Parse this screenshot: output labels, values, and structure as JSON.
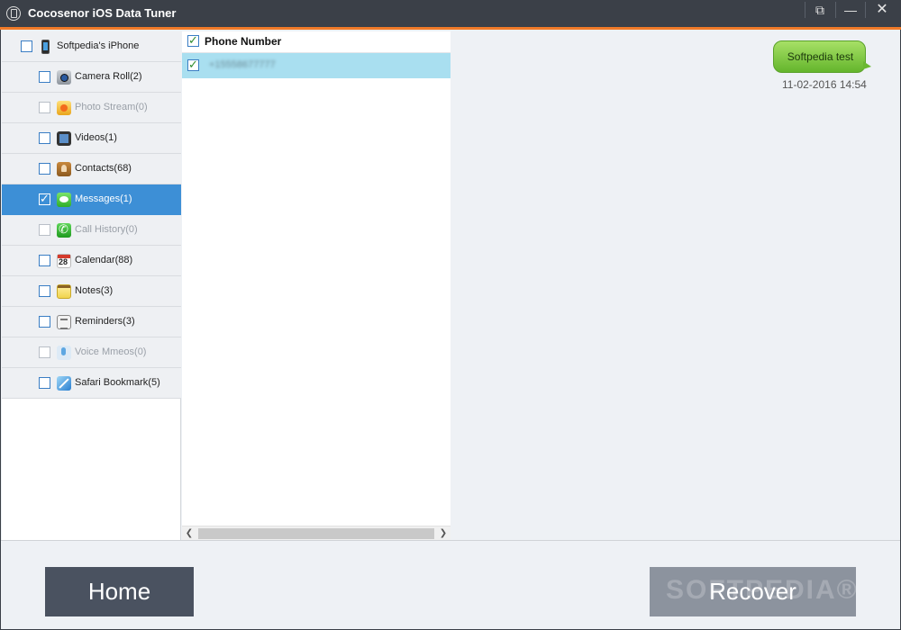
{
  "window": {
    "title": "Cocosenor iOS Data Tuner",
    "controls": [
      "restore-icon",
      "minimize-icon",
      "close-icon"
    ],
    "accent_color": "#f07a28"
  },
  "sidebar": {
    "device": {
      "label": "Softpedia's iPhone",
      "icon": "iphone-icon",
      "checked": false
    },
    "items": [
      {
        "label": "Camera Roll(2)",
        "icon": "camera-icon",
        "checked": false,
        "enabled": true
      },
      {
        "label": "Photo Stream(0)",
        "icon": "photo-stream-icon",
        "checked": false,
        "enabled": false
      },
      {
        "label": "Videos(1)",
        "icon": "video-icon",
        "checked": false,
        "enabled": true
      },
      {
        "label": "Contacts(68)",
        "icon": "contacts-icon",
        "checked": false,
        "enabled": true
      },
      {
        "label": "Messages(1)",
        "icon": "messages-icon",
        "checked": true,
        "enabled": true,
        "selected": true
      },
      {
        "label": "Call History(0)",
        "icon": "phone-call-icon",
        "checked": false,
        "enabled": false
      },
      {
        "label": "Calendar(88)",
        "icon": "calendar-icon",
        "checked": false,
        "enabled": true
      },
      {
        "label": "Notes(3)",
        "icon": "notes-icon",
        "checked": false,
        "enabled": true
      },
      {
        "label": "Reminders(3)",
        "icon": "reminders-icon",
        "checked": false,
        "enabled": true
      },
      {
        "label": "Voice Mmeos(0)",
        "icon": "voice-memo-icon",
        "checked": false,
        "enabled": false
      },
      {
        "label": "Safari Bookmark(5)",
        "icon": "safari-icon",
        "checked": false,
        "enabled": true
      }
    ],
    "selected_color": "#3d8fd6"
  },
  "list": {
    "header": "Phone Number",
    "header_checked": true,
    "rows": [
      {
        "value": "+15558677777",
        "checked": true,
        "selected": true,
        "blurred": true
      }
    ]
  },
  "detail": {
    "message_text": "Softpedia test",
    "message_time": "11-02-2016 14:54",
    "bubble_color": "#8fd14f"
  },
  "footer": {
    "home_label": "Home",
    "recover_label": "Recover",
    "watermark": "SOFTPEDIA®"
  }
}
